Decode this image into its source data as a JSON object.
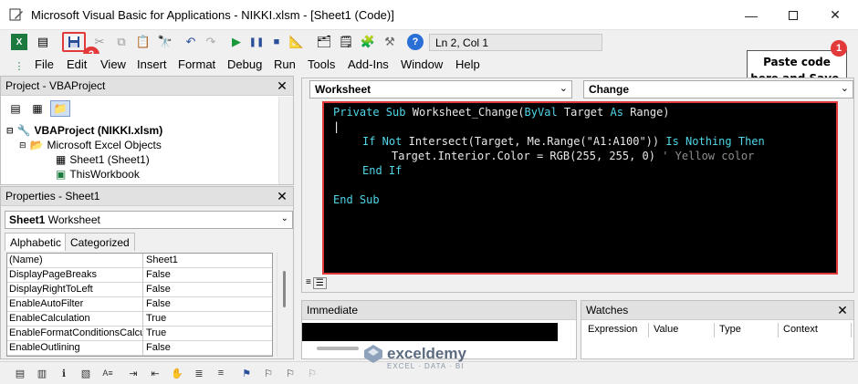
{
  "window": {
    "title": "Microsoft Visual Basic for Applications - NIKKI.xlsm - [Sheet1 (Code)]",
    "minimize_icon": "minimize-icon",
    "maximize_icon": "maximize-icon",
    "close_icon": "close-icon"
  },
  "toolbar": {
    "position": "Ln 2, Col 1",
    "icons": [
      "excel-icon",
      "insert-module-icon",
      "save-icon",
      "cut-icon",
      "copy-icon",
      "paste-icon",
      "find-icon",
      "undo-icon",
      "redo-icon",
      "run-icon",
      "break-icon",
      "reset-icon",
      "design-mode-icon",
      "project-explorer-icon",
      "properties-icon",
      "object-browser-icon",
      "toolbox-icon",
      "help-icon"
    ]
  },
  "menu": {
    "items": [
      "File",
      "Edit",
      "View",
      "Insert",
      "Format",
      "Debug",
      "Run",
      "Tools",
      "Add-Ins",
      "Window",
      "Help"
    ]
  },
  "project": {
    "header": "Project - VBAProject",
    "root": "VBAProject (NIKKI.xlsm)",
    "folder": "Microsoft Excel Objects",
    "sheet": "Sheet1 (Sheet1)",
    "workbook": "ThisWorkbook"
  },
  "properties": {
    "header": "Properties - Sheet1",
    "object_name": "Sheet1",
    "object_type": "Worksheet",
    "tabs": [
      "Alphabetic",
      "Categorized"
    ],
    "rows": [
      {
        "name": "(Name)",
        "value": "Sheet1"
      },
      {
        "name": "DisplayPageBreaks",
        "value": "False"
      },
      {
        "name": "DisplayRightToLeft",
        "value": "False"
      },
      {
        "name": "EnableAutoFilter",
        "value": "False"
      },
      {
        "name": "EnableCalculation",
        "value": "True"
      },
      {
        "name": "EnableFormatConditionsCalcula",
        "value": "True"
      },
      {
        "name": "EnableOutlining",
        "value": "False"
      }
    ]
  },
  "code": {
    "object_combo": "Worksheet",
    "procedure_combo": "Change",
    "lines": {
      "l1_kw1": "Private Sub",
      "l1_tx1": "Worksheet_Change(",
      "l1_kw2": "ByVal",
      "l1_tx2": "Target",
      "l1_kw3": "As",
      "l1_tx3": "Range)",
      "l3_kw1": "If Not",
      "l3_tx1": "Intersect(Target, Me.Range(\"A1:A100\"))",
      "l3_kw2": "Is Nothing Then",
      "l4_tx1": "Target.Interior.Color = RGB(255, 255, 0)",
      "l4_cm": "' Yellow color",
      "l5_kw": "End If",
      "l7_kw": "End Sub"
    }
  },
  "annotations": {
    "callout": "Paste code here and Save.",
    "badge1": "1",
    "badge2": "2",
    "accent": "#e23a3a"
  },
  "immediate": {
    "header": "Immediate"
  },
  "watches": {
    "header": "Watches",
    "columns": [
      "Expression",
      "Value",
      "Type",
      "Context"
    ]
  },
  "watermark": {
    "name": "exceldemy",
    "tagline": "EXCEL · DATA · BI"
  }
}
